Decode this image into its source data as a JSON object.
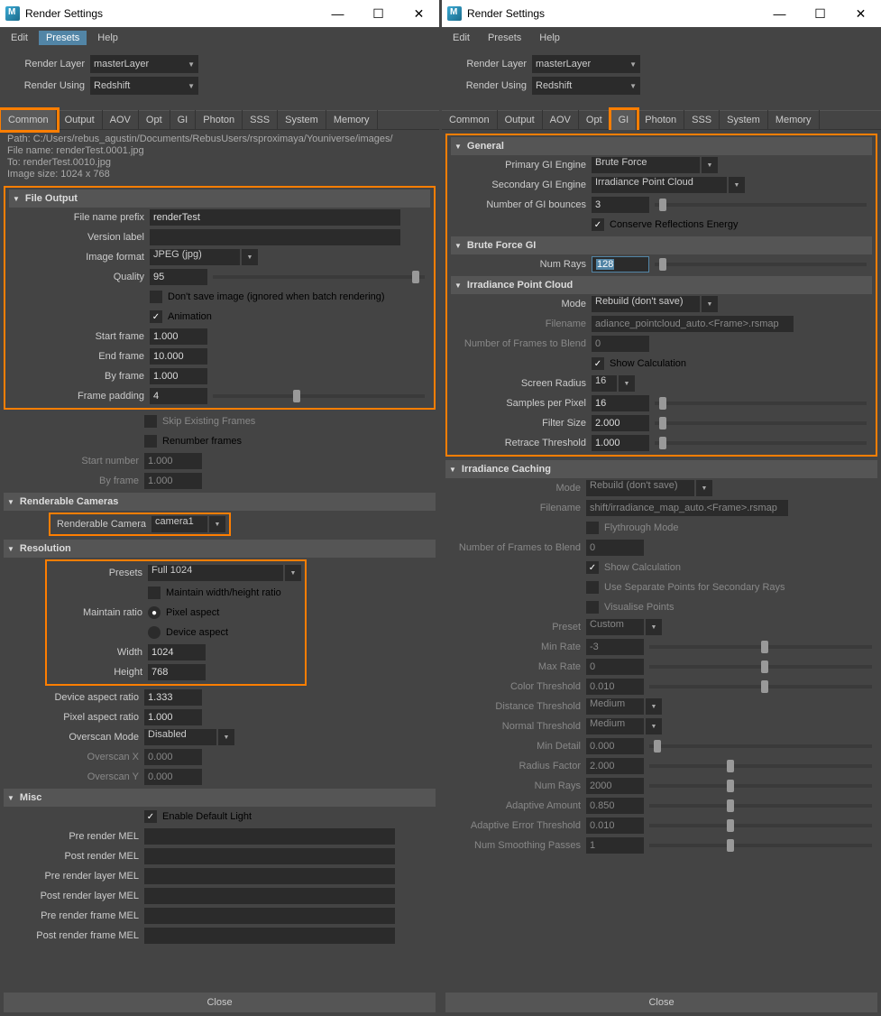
{
  "title": "Render Settings",
  "win_btns": {
    "min": "—",
    "max": "☐",
    "close": "✕"
  },
  "menubar": [
    "Edit",
    "Presets",
    "Help"
  ],
  "headerForm": {
    "renderLayer": {
      "label": "Render Layer",
      "value": "masterLayer"
    },
    "renderUsing": {
      "label": "Render Using",
      "value": "Redshift"
    }
  },
  "tabs": [
    "Common",
    "Output",
    "AOV",
    "Opt",
    "GI",
    "Photon",
    "SSS",
    "System",
    "Memory"
  ],
  "left": {
    "activeTab": "Common",
    "info": {
      "path": "Path: C:/Users/rebus_agustin/Documents/RebusUsers/rsproximaya/Youniverse/images/",
      "filename": "File name:  renderTest.0001.jpg",
      "to": "To:            renderTest.0010.jpg",
      "size": "Image size: 1024 x 768"
    },
    "fileOutput": {
      "title": "File Output",
      "prefix": {
        "label": "File name prefix",
        "value": "renderTest"
      },
      "versionLabel": {
        "label": "Version label",
        "value": ""
      },
      "imageFormat": {
        "label": "Image format",
        "value": "JPEG (jpg)"
      },
      "quality": {
        "label": "Quality",
        "value": "95"
      },
      "dontSave": {
        "label": "Don't save image (ignored when batch rendering)",
        "checked": false
      },
      "animation": {
        "label": "Animation",
        "checked": true
      },
      "startFrame": {
        "label": "Start frame",
        "value": "1.000"
      },
      "endFrame": {
        "label": "End frame",
        "value": "10.000"
      },
      "byFrame": {
        "label": "By frame",
        "value": "1.000"
      },
      "framePadding": {
        "label": "Frame padding",
        "value": "4"
      }
    },
    "extra": {
      "skipExisting": {
        "label": "Skip Existing Frames",
        "checked": false
      },
      "renumber": {
        "label": "Renumber frames",
        "checked": false
      },
      "startNumber": {
        "label": "Start number",
        "value": "1.000"
      },
      "byFrame": {
        "label": "By frame",
        "value": "1.000"
      }
    },
    "cameras": {
      "title": "Renderable Cameras",
      "camera": {
        "label": "Renderable Camera",
        "value": "camera1"
      }
    },
    "resolution": {
      "title": "Resolution",
      "presets": {
        "label": "Presets",
        "value": "Full 1024"
      },
      "maintainWH": {
        "label": "Maintain width/height ratio",
        "checked": false
      },
      "maintainRatio": {
        "label": "Maintain ratio",
        "opt1": "Pixel aspect",
        "opt2": "Device aspect"
      },
      "width": {
        "label": "Width",
        "value": "1024"
      },
      "height": {
        "label": "Height",
        "value": "768"
      },
      "deviceAspect": {
        "label": "Device aspect ratio",
        "value": "1.333"
      },
      "pixelAspect": {
        "label": "Pixel aspect ratio",
        "value": "1.000"
      },
      "overscanMode": {
        "label": "Overscan Mode",
        "value": "Disabled"
      },
      "overscanX": {
        "label": "Overscan X",
        "value": "0.000"
      },
      "overscanY": {
        "label": "Overscan Y",
        "value": "0.000"
      }
    },
    "misc": {
      "title": "Misc",
      "enableDefaultLight": {
        "label": "Enable Default Light",
        "checked": true
      },
      "mel": [
        {
          "label": "Pre render MEL",
          "value": ""
        },
        {
          "label": "Post render MEL",
          "value": ""
        },
        {
          "label": "Pre render layer MEL",
          "value": ""
        },
        {
          "label": "Post render layer MEL",
          "value": ""
        },
        {
          "label": "Pre render frame MEL",
          "value": ""
        },
        {
          "label": "Post render frame MEL",
          "value": ""
        }
      ]
    }
  },
  "right": {
    "activeTab": "GI",
    "general": {
      "title": "General",
      "primaryGI": {
        "label": "Primary GI Engine",
        "value": "Brute Force"
      },
      "secondaryGI": {
        "label": "Secondary GI Engine",
        "value": "Irradiance Point Cloud"
      },
      "bounces": {
        "label": "Number of GI bounces",
        "value": "3"
      },
      "conserve": {
        "label": "Conserve Reflections Energy",
        "checked": true
      }
    },
    "bruteForce": {
      "title": "Brute Force GI",
      "numRays": {
        "label": "Num Rays",
        "value": "128"
      }
    },
    "ipc": {
      "title": "Irradiance Point Cloud",
      "mode": {
        "label": "Mode",
        "value": "Rebuild (don't save)"
      },
      "filename": {
        "label": "Filename",
        "value": "adiance_pointcloud_auto.<Frame>.rsmap"
      },
      "framesBlend": {
        "label": "Number of Frames to Blend",
        "value": "0"
      },
      "showCalc": {
        "label": "Show Calculation",
        "checked": true
      },
      "screenRadius": {
        "label": "Screen Radius",
        "value": "16"
      },
      "samplesPerPixel": {
        "label": "Samples per Pixel",
        "value": "16"
      },
      "filterSize": {
        "label": "Filter Size",
        "value": "2.000"
      },
      "retrace": {
        "label": "Retrace Threshold",
        "value": "1.000"
      }
    },
    "irrCache": {
      "title": "Irradiance Caching",
      "mode": {
        "label": "Mode",
        "value": "Rebuild (don't save)"
      },
      "filename": {
        "label": "Filename",
        "value": "shift/irradiance_map_auto.<Frame>.rsmap"
      },
      "flythrough": {
        "label": "Flythrough Mode",
        "checked": false
      },
      "framesBlend": {
        "label": "Number of Frames to Blend",
        "value": "0"
      },
      "showCalc": {
        "label": "Show Calculation",
        "checked": true
      },
      "useSep": {
        "label": "Use Separate Points for Secondary Rays",
        "checked": false
      },
      "visualise": {
        "label": "Visualise Points",
        "checked": false
      },
      "preset": {
        "label": "Preset",
        "value": "Custom"
      },
      "minRate": {
        "label": "Min Rate",
        "value": "-3"
      },
      "maxRate": {
        "label": "Max Rate",
        "value": "0"
      },
      "colorThreshold": {
        "label": "Color Threshold",
        "value": "0.010"
      },
      "distThreshold": {
        "label": "Distance Threshold",
        "value": "Medium"
      },
      "normalThreshold": {
        "label": "Normal Threshold",
        "value": "Medium"
      },
      "minDetail": {
        "label": "Min Detail",
        "value": "0.000"
      },
      "radiusFactor": {
        "label": "Radius Factor",
        "value": "2.000"
      },
      "numRays": {
        "label": "Num Rays",
        "value": "2000"
      },
      "adaptiveAmount": {
        "label": "Adaptive Amount",
        "value": "0.850"
      },
      "adaptiveError": {
        "label": "Adaptive Error Threshold",
        "value": "0.010"
      },
      "smoothing": {
        "label": "Num Smoothing Passes",
        "value": "1"
      }
    }
  },
  "closeBtn": "Close"
}
